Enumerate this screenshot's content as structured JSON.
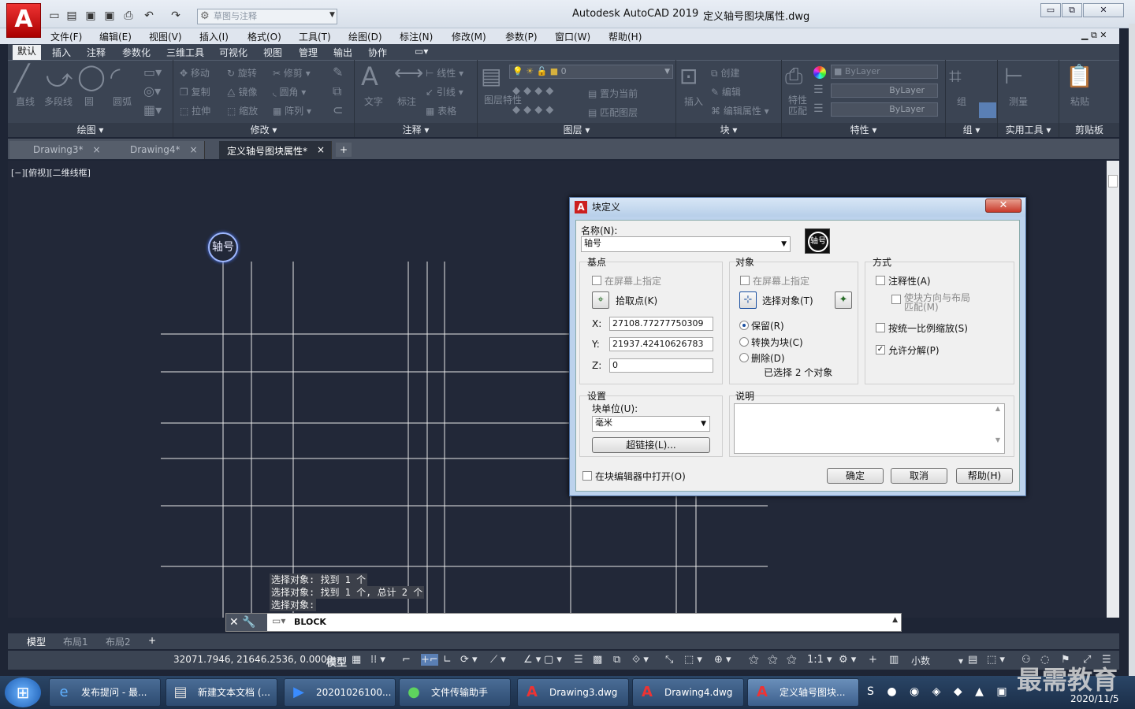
{
  "app": {
    "logo": "A",
    "app_name": "Autodesk AutoCAD 2019",
    "doc_name": "定义轴号图块属性.dwg",
    "qat_combo": "草图与注释",
    "win_controls": [
      "▭",
      "⧉",
      "✕"
    ]
  },
  "menu": [
    "文件(F)",
    "编辑(E)",
    "视图(V)",
    "插入(I)",
    "格式(O)",
    "工具(T)",
    "绘图(D)",
    "标注(N)",
    "修改(M)",
    "参数(P)",
    "窗口(W)",
    "帮助(H)"
  ],
  "ribbon_tabs": [
    "默认",
    "插入",
    "注释",
    "参数化",
    "三维工具",
    "可视化",
    "视图",
    "管理",
    "输出",
    "协作"
  ],
  "ribbon": {
    "draw": {
      "title": "绘图 ▾",
      "items": [
        "直线",
        "多段线",
        "圆",
        "圆弧"
      ]
    },
    "modify": {
      "title": "修改 ▾",
      "items": [
        "移动",
        "旋转",
        "修剪",
        "复制",
        "镜像",
        "圆角",
        "拉伸",
        "缩放",
        "阵列"
      ]
    },
    "annotate": {
      "title": "注释 ▾",
      "items": [
        "文字",
        "标注",
        "线性",
        "引线",
        "表格"
      ]
    },
    "layers": {
      "title": "图层 ▾",
      "combo": "0",
      "items": [
        "图层特性",
        "置为当前",
        "匹配图层"
      ]
    },
    "block": {
      "title": "块 ▾",
      "items": [
        "插入",
        "创建",
        "编辑",
        "编辑属性"
      ]
    },
    "properties": {
      "title": "特性 ▾",
      "items": [
        "特性匹配",
        "ByLayer",
        "ByLayer",
        "ByLayer"
      ]
    },
    "group": {
      "title": "组 ▾",
      "items": [
        "组"
      ]
    },
    "utilities": {
      "title": "实用工具 ▾",
      "items": [
        "测量"
      ]
    },
    "clipboard": {
      "title": "剪贴板",
      "items": [
        "粘贴"
      ]
    }
  },
  "doc_tabs": [
    "Drawing3*",
    "Drawing4*",
    "定义轴号图块属性*"
  ],
  "view_label": "[−][俯视][二维线框]",
  "axis_bubble": "轴号",
  "command": {
    "history": [
      "选择对象: 找到 1 个",
      "选择对象: 找到 1 个, 总计 2 个",
      "选择对象:"
    ],
    "current": "BLOCK"
  },
  "layout_tabs": [
    "模型",
    "布局1",
    "布局2"
  ],
  "status": {
    "coords": "32071.7946, 21646.2536, 0.0000",
    "model": "模型",
    "scale": "1:1",
    "units": "小数"
  },
  "dialog": {
    "title": "块定义",
    "name_label": "名称(N):",
    "name_value": "轴号",
    "preview": "轴号",
    "base_point": {
      "title": "基点",
      "on_screen": "在屏幕上指定",
      "pick_label": "拾取点(K)",
      "x_label": "X:",
      "x": "27108.77277750309",
      "y_label": "Y:",
      "y": "21937.42410626783",
      "z_label": "Z:",
      "z": "0"
    },
    "objects": {
      "title": "对象",
      "on_screen": "在屏幕上指定",
      "select_label": "选择对象(T)",
      "retain": "保留(R)",
      "convert": "转换为块(C)",
      "delete": "删除(D)",
      "selected_info": "已选择 2 个对象"
    },
    "behavior": {
      "title": "方式",
      "annotative": "注释性(A)",
      "match_orientation_1": "使块方向与布局",
      "match_orientation_2": "匹配(M)",
      "uniform_scale": "按统一比例缩放(S)",
      "allow_explode": "允许分解(P)"
    },
    "settings": {
      "title": "设置",
      "unit_label": "块单位(U):",
      "unit_value": "毫米",
      "hyperlink": "超链接(L)..."
    },
    "description": {
      "title": "说明",
      "value": ""
    },
    "open_in_editor": "在块编辑器中打开(O)",
    "ok": "确定",
    "cancel": "取消",
    "help": "帮助(H)"
  },
  "taskbar": {
    "items": [
      "发布提问 - 最...",
      "新建文本文档 (...",
      "20201026100...",
      "文件传输助手",
      "Drawing3.dwg",
      "Drawing4.dwg",
      "定义轴号图块..."
    ],
    "date": "2020/11/5"
  },
  "watermark": "最需教育",
  "colors": {
    "canvas": "#222838",
    "ribbon": "#3b4453",
    "accent": "#1a4fa0",
    "autocad_red": "#cc1f1f"
  }
}
